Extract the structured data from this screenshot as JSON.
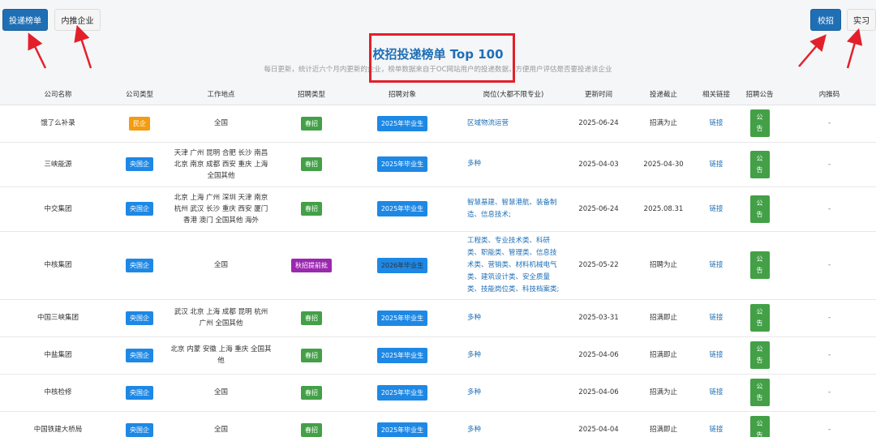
{
  "nav": {
    "left": [
      {
        "label": "投递榜单",
        "style": "primary"
      },
      {
        "label": "内推企业",
        "style": "light"
      }
    ],
    "right": [
      {
        "label": "校招",
        "style": "primary"
      },
      {
        "label": "实习",
        "style": "light"
      }
    ]
  },
  "header": {
    "title": "校招投递榜单 Top 100",
    "subtitle": "每日更新，统计近六个月内更新的企业，榜单数据来自于OC网站用户的投递数据，方便用户评估是否要投递该企业"
  },
  "colors": {
    "accent": "#1f6fb5",
    "highlight_box": "#e3202a",
    "arrow": "#e3202a"
  },
  "table": {
    "columns": [
      "公司名称",
      "公司类型",
      "工作地点",
      "招聘类型",
      "招聘对象",
      "岗位(大都不限专业)",
      "更新时间",
      "投递截止",
      "相关链接",
      "招聘公告",
      "内推码"
    ],
    "rows": [
      {
        "company": "饿了么补录",
        "type": "民企",
        "type_color": "orange",
        "location": "全国",
        "recruit": "春招",
        "recruit_color": "green",
        "target": "2025年毕业生",
        "target_color": "blue",
        "position": "区域物流运营",
        "updated": "2025-06-24",
        "deadline": "招满为止",
        "link": "链接",
        "notice1": "公",
        "notice2": "告",
        "code": "-"
      },
      {
        "company": "三峡能源",
        "type": "央国企",
        "type_color": "blue",
        "location": "天津 广州 昆明 合肥 长沙 南昌 北京 南京 成都 西安 重庆 上海 全国其他",
        "recruit": "春招",
        "recruit_color": "green",
        "target": "2025年毕业生",
        "target_color": "blue",
        "position": "多种",
        "updated": "2025-04-03",
        "deadline": "2025-04-30",
        "link": "链接",
        "notice1": "公",
        "notice2": "告",
        "code": "-"
      },
      {
        "company": "中交集团",
        "type": "央国企",
        "type_color": "blue",
        "location": "北京 上海 广州 深圳 天津 南京 杭州 武汉 长沙 重庆 西安 厦门 香港 澳门 全国其他 海外",
        "recruit": "春招",
        "recruit_color": "green",
        "target": "2025年毕业生",
        "target_color": "blue",
        "position": "智慧基建、智慧港航、装备制造、信息技术;",
        "updated": "2025-06-24",
        "deadline": "2025.08.31",
        "link": "链接",
        "notice1": "公",
        "notice2": "告",
        "code": "-"
      },
      {
        "company": "中核集团",
        "type": "央国企",
        "type_color": "blue",
        "location": "全国",
        "recruit": "秋招提前批",
        "recruit_color": "purple",
        "target": "2026年毕业生",
        "target_color": "yellow",
        "position": "工程类、专业技术类、科研类、职能类、管理类、信息技术类、营销类、材料机械电气类、建筑设计类、安全质量类、技能岗位类、科技档案类;",
        "updated": "2025-05-22",
        "deadline": "招聘为止",
        "link": "链接",
        "notice1": "公",
        "notice2": "告",
        "code": "-"
      },
      {
        "company": "中国三峡集团",
        "type": "央国企",
        "type_color": "blue",
        "location": "武汉 北京 上海 成都 昆明 杭州 广州 全国其他",
        "recruit": "春招",
        "recruit_color": "green",
        "target": "2025年毕业生",
        "target_color": "blue",
        "position": "多种",
        "updated": "2025-03-31",
        "deadline": "招满即止",
        "link": "链接",
        "notice1": "公",
        "notice2": "告",
        "code": "-"
      },
      {
        "company": "中盐集团",
        "type": "央国企",
        "type_color": "blue",
        "location": "北京 内蒙 安徽 上海 重庆 全国其他",
        "recruit": "春招",
        "recruit_color": "green",
        "target": "2025年毕业生",
        "target_color": "blue",
        "position": "多种",
        "updated": "2025-04-06",
        "deadline": "招满即止",
        "link": "链接",
        "notice1": "公",
        "notice2": "告",
        "code": "-"
      },
      {
        "company": "中核检修",
        "type": "央国企",
        "type_color": "blue",
        "location": "全国",
        "recruit": "春招",
        "recruit_color": "green",
        "target": "2025年毕业生",
        "target_color": "blue",
        "position": "多种",
        "updated": "2025-04-06",
        "deadline": "招满为止",
        "link": "链接",
        "notice1": "公",
        "notice2": "告",
        "code": "-"
      },
      {
        "company": "中国铁建大桥局",
        "type": "央国企",
        "type_color": "blue",
        "location": "全国",
        "recruit": "春招",
        "recruit_color": "green",
        "target": "2025年毕业生",
        "target_color": "blue",
        "position": "多种",
        "updated": "2025-04-04",
        "deadline": "招满即止",
        "link": "链接",
        "notice1": "公",
        "notice2": "告",
        "code": "-"
      }
    ]
  }
}
